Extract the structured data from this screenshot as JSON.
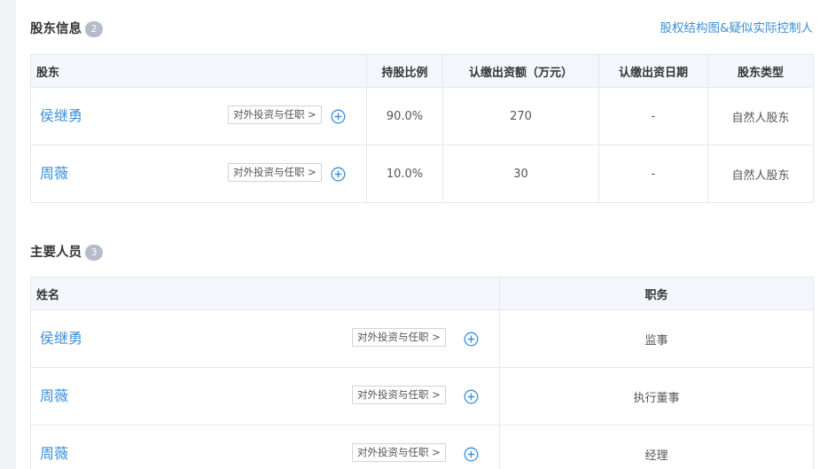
{
  "shareholders": {
    "title": "股东信息",
    "count": "2",
    "link": "股权结构图&疑似实际控制人",
    "headers": [
      "股东",
      "持股比例",
      "认缴出资额（万元）",
      "认缴出资日期",
      "股东类型"
    ],
    "rows": [
      {
        "name": "侯继勇",
        "action": "对外投资与任职 >",
        "ratio": "90.0%",
        "amount": "270",
        "date": "-",
        "type": "自然人股东"
      },
      {
        "name": "周薇",
        "action": "对外投资与任职 >",
        "ratio": "10.0%",
        "amount": "30",
        "date": "-",
        "type": "自然人股东"
      }
    ]
  },
  "personnel": {
    "title": "主要人员",
    "count": "3",
    "headers": [
      "姓名",
      "职务"
    ],
    "rows": [
      {
        "name": "侯继勇",
        "action": "对外投资与任职 >",
        "position": "监事"
      },
      {
        "name": "周薇",
        "action": "对外投资与任职 >",
        "position": "执行董事"
      },
      {
        "name": "周薇",
        "action": "对外投资与任职 >",
        "position": "经理"
      }
    ]
  },
  "icons": {
    "add": "plus-circle-icon"
  },
  "colors": {
    "link": "#3b8fd7",
    "badge": "#b5bcc9",
    "header_bg": "#f3f7fc",
    "border": "#e4e8ef"
  }
}
